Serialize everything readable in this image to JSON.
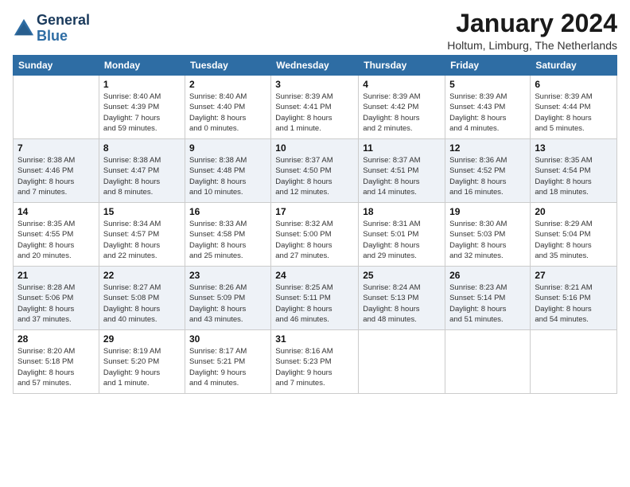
{
  "header": {
    "logo_line1": "General",
    "logo_line2": "Blue",
    "month_title": "January 2024",
    "location": "Holtum, Limburg, The Netherlands"
  },
  "weekdays": [
    "Sunday",
    "Monday",
    "Tuesday",
    "Wednesday",
    "Thursday",
    "Friday",
    "Saturday"
  ],
  "weeks": [
    [
      {
        "day": "",
        "info": ""
      },
      {
        "day": "1",
        "info": "Sunrise: 8:40 AM\nSunset: 4:39 PM\nDaylight: 7 hours\nand 59 minutes."
      },
      {
        "day": "2",
        "info": "Sunrise: 8:40 AM\nSunset: 4:40 PM\nDaylight: 8 hours\nand 0 minutes."
      },
      {
        "day": "3",
        "info": "Sunrise: 8:39 AM\nSunset: 4:41 PM\nDaylight: 8 hours\nand 1 minute."
      },
      {
        "day": "4",
        "info": "Sunrise: 8:39 AM\nSunset: 4:42 PM\nDaylight: 8 hours\nand 2 minutes."
      },
      {
        "day": "5",
        "info": "Sunrise: 8:39 AM\nSunset: 4:43 PM\nDaylight: 8 hours\nand 4 minutes."
      },
      {
        "day": "6",
        "info": "Sunrise: 8:39 AM\nSunset: 4:44 PM\nDaylight: 8 hours\nand 5 minutes."
      }
    ],
    [
      {
        "day": "7",
        "info": "Sunrise: 8:38 AM\nSunset: 4:46 PM\nDaylight: 8 hours\nand 7 minutes."
      },
      {
        "day": "8",
        "info": "Sunrise: 8:38 AM\nSunset: 4:47 PM\nDaylight: 8 hours\nand 8 minutes."
      },
      {
        "day": "9",
        "info": "Sunrise: 8:38 AM\nSunset: 4:48 PM\nDaylight: 8 hours\nand 10 minutes."
      },
      {
        "day": "10",
        "info": "Sunrise: 8:37 AM\nSunset: 4:50 PM\nDaylight: 8 hours\nand 12 minutes."
      },
      {
        "day": "11",
        "info": "Sunrise: 8:37 AM\nSunset: 4:51 PM\nDaylight: 8 hours\nand 14 minutes."
      },
      {
        "day": "12",
        "info": "Sunrise: 8:36 AM\nSunset: 4:52 PM\nDaylight: 8 hours\nand 16 minutes."
      },
      {
        "day": "13",
        "info": "Sunrise: 8:35 AM\nSunset: 4:54 PM\nDaylight: 8 hours\nand 18 minutes."
      }
    ],
    [
      {
        "day": "14",
        "info": "Sunrise: 8:35 AM\nSunset: 4:55 PM\nDaylight: 8 hours\nand 20 minutes."
      },
      {
        "day": "15",
        "info": "Sunrise: 8:34 AM\nSunset: 4:57 PM\nDaylight: 8 hours\nand 22 minutes."
      },
      {
        "day": "16",
        "info": "Sunrise: 8:33 AM\nSunset: 4:58 PM\nDaylight: 8 hours\nand 25 minutes."
      },
      {
        "day": "17",
        "info": "Sunrise: 8:32 AM\nSunset: 5:00 PM\nDaylight: 8 hours\nand 27 minutes."
      },
      {
        "day": "18",
        "info": "Sunrise: 8:31 AM\nSunset: 5:01 PM\nDaylight: 8 hours\nand 29 minutes."
      },
      {
        "day": "19",
        "info": "Sunrise: 8:30 AM\nSunset: 5:03 PM\nDaylight: 8 hours\nand 32 minutes."
      },
      {
        "day": "20",
        "info": "Sunrise: 8:29 AM\nSunset: 5:04 PM\nDaylight: 8 hours\nand 35 minutes."
      }
    ],
    [
      {
        "day": "21",
        "info": "Sunrise: 8:28 AM\nSunset: 5:06 PM\nDaylight: 8 hours\nand 37 minutes."
      },
      {
        "day": "22",
        "info": "Sunrise: 8:27 AM\nSunset: 5:08 PM\nDaylight: 8 hours\nand 40 minutes."
      },
      {
        "day": "23",
        "info": "Sunrise: 8:26 AM\nSunset: 5:09 PM\nDaylight: 8 hours\nand 43 minutes."
      },
      {
        "day": "24",
        "info": "Sunrise: 8:25 AM\nSunset: 5:11 PM\nDaylight: 8 hours\nand 46 minutes."
      },
      {
        "day": "25",
        "info": "Sunrise: 8:24 AM\nSunset: 5:13 PM\nDaylight: 8 hours\nand 48 minutes."
      },
      {
        "day": "26",
        "info": "Sunrise: 8:23 AM\nSunset: 5:14 PM\nDaylight: 8 hours\nand 51 minutes."
      },
      {
        "day": "27",
        "info": "Sunrise: 8:21 AM\nSunset: 5:16 PM\nDaylight: 8 hours\nand 54 minutes."
      }
    ],
    [
      {
        "day": "28",
        "info": "Sunrise: 8:20 AM\nSunset: 5:18 PM\nDaylight: 8 hours\nand 57 minutes."
      },
      {
        "day": "29",
        "info": "Sunrise: 8:19 AM\nSunset: 5:20 PM\nDaylight: 9 hours\nand 1 minute."
      },
      {
        "day": "30",
        "info": "Sunrise: 8:17 AM\nSunset: 5:21 PM\nDaylight: 9 hours\nand 4 minutes."
      },
      {
        "day": "31",
        "info": "Sunrise: 8:16 AM\nSunset: 5:23 PM\nDaylight: 9 hours\nand 7 minutes."
      },
      {
        "day": "",
        "info": ""
      },
      {
        "day": "",
        "info": ""
      },
      {
        "day": "",
        "info": ""
      }
    ]
  ]
}
